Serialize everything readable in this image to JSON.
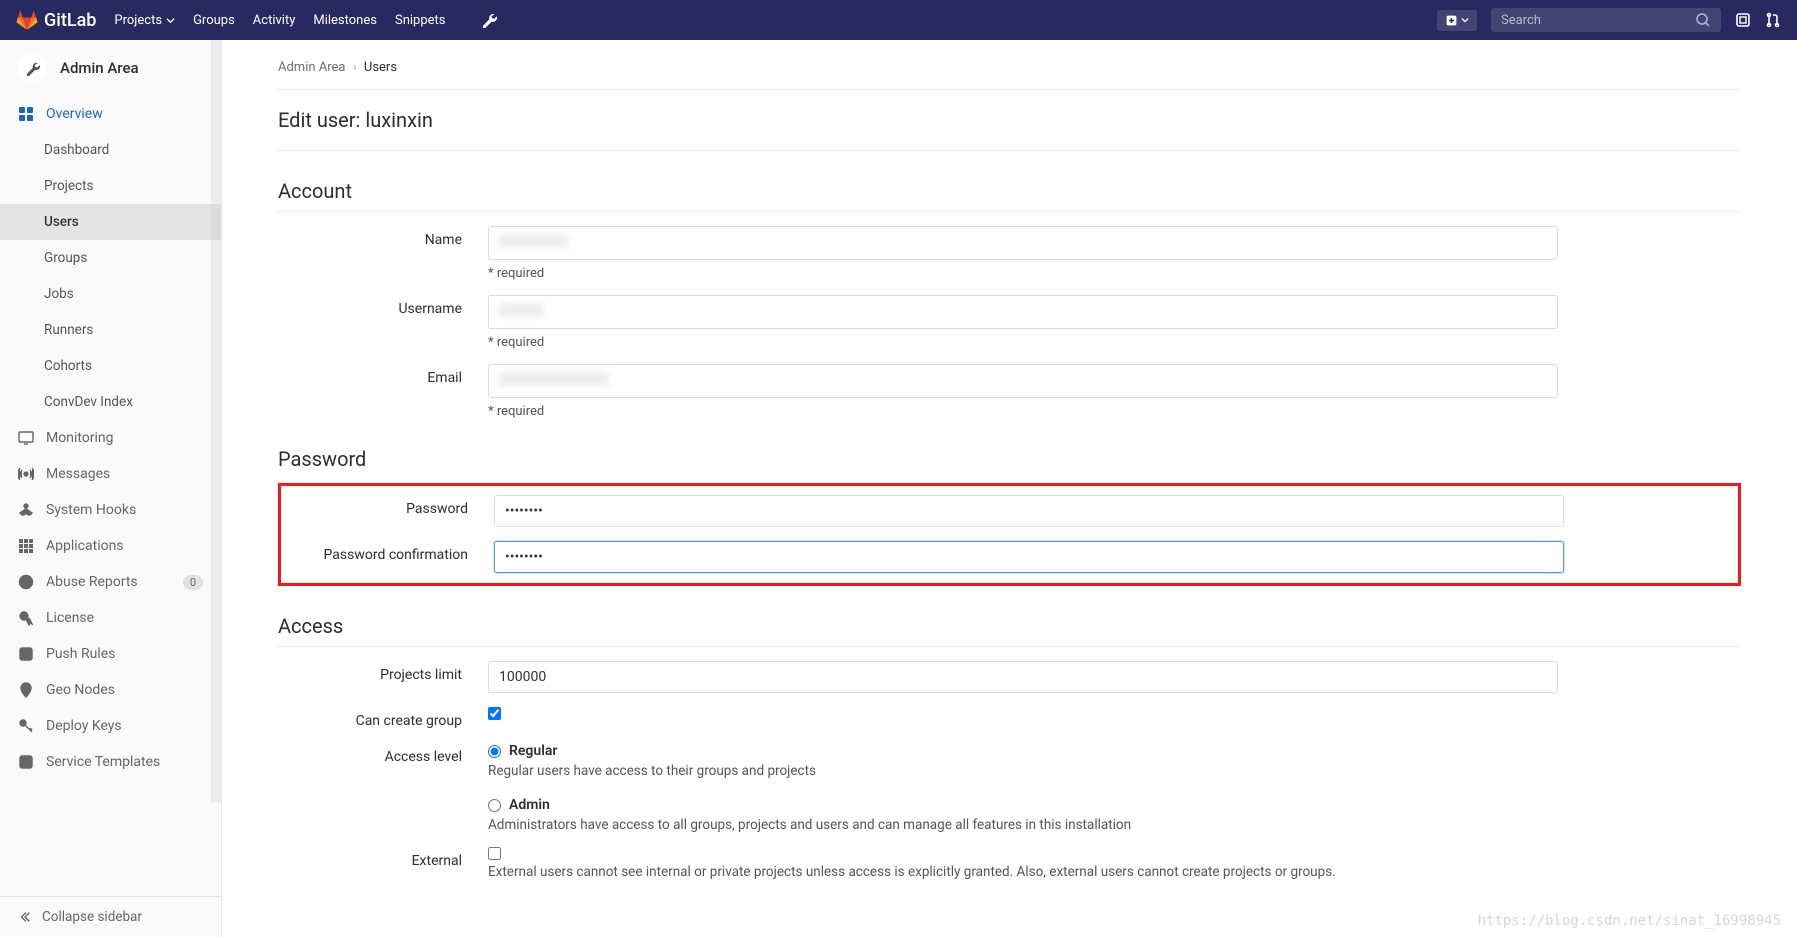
{
  "brand": "GitLab",
  "nav": {
    "projects": "Projects",
    "groups": "Groups",
    "activity": "Activity",
    "milestones": "Milestones",
    "snippets": "Snippets"
  },
  "search": {
    "placeholder": "Search"
  },
  "sidebar": {
    "title": "Admin Area",
    "overview": "Overview",
    "overview_items": [
      "Dashboard",
      "Projects",
      "Users",
      "Groups",
      "Jobs",
      "Runners",
      "Cohorts",
      "ConvDev Index"
    ],
    "monitoring": "Monitoring",
    "messages": "Messages",
    "system_hooks": "System Hooks",
    "applications": "Applications",
    "abuse_reports": "Abuse Reports",
    "abuse_count": "0",
    "license": "License",
    "push_rules": "Push Rules",
    "geo_nodes": "Geo Nodes",
    "deploy_keys": "Deploy Keys",
    "service_templates": "Service Templates",
    "collapse": "Collapse sidebar"
  },
  "breadcrumb": {
    "root": "Admin Area",
    "current": "Users"
  },
  "page": {
    "title": "Edit user: luxinxin"
  },
  "sections": {
    "account": "Account",
    "password": "Password",
    "access": "Access"
  },
  "labels": {
    "name": "Name",
    "username": "Username",
    "email": "Email",
    "required": "* required",
    "password": "Password",
    "password_confirm": "Password confirmation",
    "projects_limit": "Projects limit",
    "can_create_group": "Can create group",
    "access_level": "Access level",
    "regular": "Regular",
    "regular_desc": "Regular users have access to their groups and projects",
    "admin": "Admin",
    "admin_desc": "Administrators have access to all groups, projects and users and can manage all features in this installation",
    "external": "External",
    "external_desc": "External users cannot see internal or private projects unless access is explicitly granted. Also, external users cannot create projects or groups."
  },
  "values": {
    "password": "••••••••",
    "password_confirm": "••••••••",
    "projects_limit": "100000"
  },
  "watermark": "https://blog.csdn.net/sinat_16998945"
}
